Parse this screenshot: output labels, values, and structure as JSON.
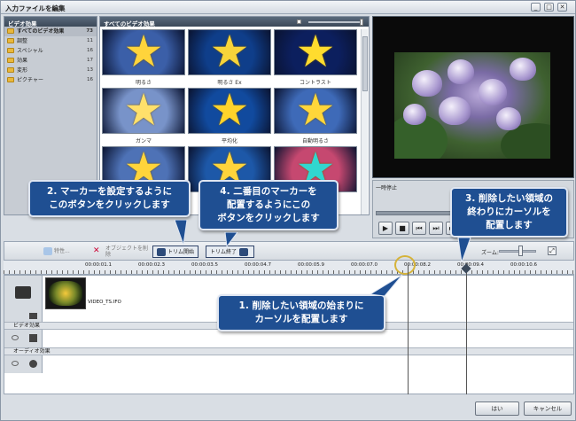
{
  "window": {
    "title": "入力ファイルを編集",
    "min": "_",
    "max": "□",
    "close": "✕"
  },
  "categories": {
    "header": "ビデオ効果",
    "items": [
      {
        "label": "すべてのビデオ効果",
        "count": "73",
        "selected": true
      },
      {
        "label": "調整",
        "count": "11",
        "selected": false
      },
      {
        "label": "スペシャル",
        "count": "16",
        "selected": false
      },
      {
        "label": "効果",
        "count": "17",
        "selected": false
      },
      {
        "label": "変形",
        "count": "13",
        "selected": false
      },
      {
        "label": "ピクチャー",
        "count": "16",
        "selected": false
      }
    ]
  },
  "effects": {
    "header": "すべてのビデオ効果",
    "items": [
      {
        "label": "明るさ",
        "bg": "#3b5fa8",
        "star": "#ffd43b"
      },
      {
        "label": "明るさ Ex",
        "bg": "#0f3e8a",
        "star": "#f7d43a"
      },
      {
        "label": "コントラスト",
        "bg": "#0c1f5e",
        "star": "#ffdc2e"
      },
      {
        "label": "ガンマ",
        "bg": "#7893c9",
        "star": "#ffe06b"
      },
      {
        "label": "平均化",
        "bg": "#114a9e",
        "star": "#ffd32a"
      },
      {
        "label": "自動明るさ",
        "bg": "#3e6ab8",
        "star": "#ffd63a"
      },
      {
        "label": "",
        "bg": "#4e72b6",
        "star": "#ffd43b"
      },
      {
        "label": "",
        "bg": "#1d58a8",
        "star": "#ffd43b"
      },
      {
        "label": "",
        "bg": "#c64870",
        "star": "#31d6cf"
      }
    ]
  },
  "player": {
    "status": "一時停止",
    "buttons": [
      {
        "icon": "play-icon",
        "glyph": "▶"
      },
      {
        "icon": "stop-icon",
        "glyph": "■"
      },
      {
        "icon": "prev-icon",
        "glyph": "⏮"
      },
      {
        "icon": "next-icon",
        "glyph": "⏭"
      },
      {
        "icon": "step-icon",
        "glyph": "▸▸"
      }
    ]
  },
  "toolbar": {
    "properties": "特性...",
    "remove": "オブジェクトを削除",
    "trim_start": "トリム開始",
    "trim_end": "トリム終了",
    "zoom": "ズーム:",
    "fit": "⤢"
  },
  "ruler": {
    "ticks": [
      "00:00:01.1",
      "00:00:02.3",
      "00:00:03.5",
      "00:00:04.7",
      "00:00:05.9",
      "00:00:07.0",
      "00:00:08.2",
      "00:00:09.4",
      "00:00:10.6"
    ]
  },
  "tracks": {
    "clip_label": "VIDEO_TS.IFO",
    "video_effects": "ビデオ効果",
    "audio_effects": "オーディオ効果"
  },
  "footer": {
    "ok": "はい",
    "cancel": "キャンセル"
  },
  "callouts": {
    "c1": "1. 削除したい領域の始まりに\nカーソルを配置します",
    "c2": "2. マーカーを設定するように\nこのボタンをクリックします",
    "c3": "3. 削除したい領域の\n終わりにカーソルを\n配置します",
    "c4": "4. 二番目のマーカーを\n配置するようにこの\nボタンをクリックします"
  },
  "colors": {
    "callout": "#1f4f92",
    "accent": "#31456a"
  }
}
